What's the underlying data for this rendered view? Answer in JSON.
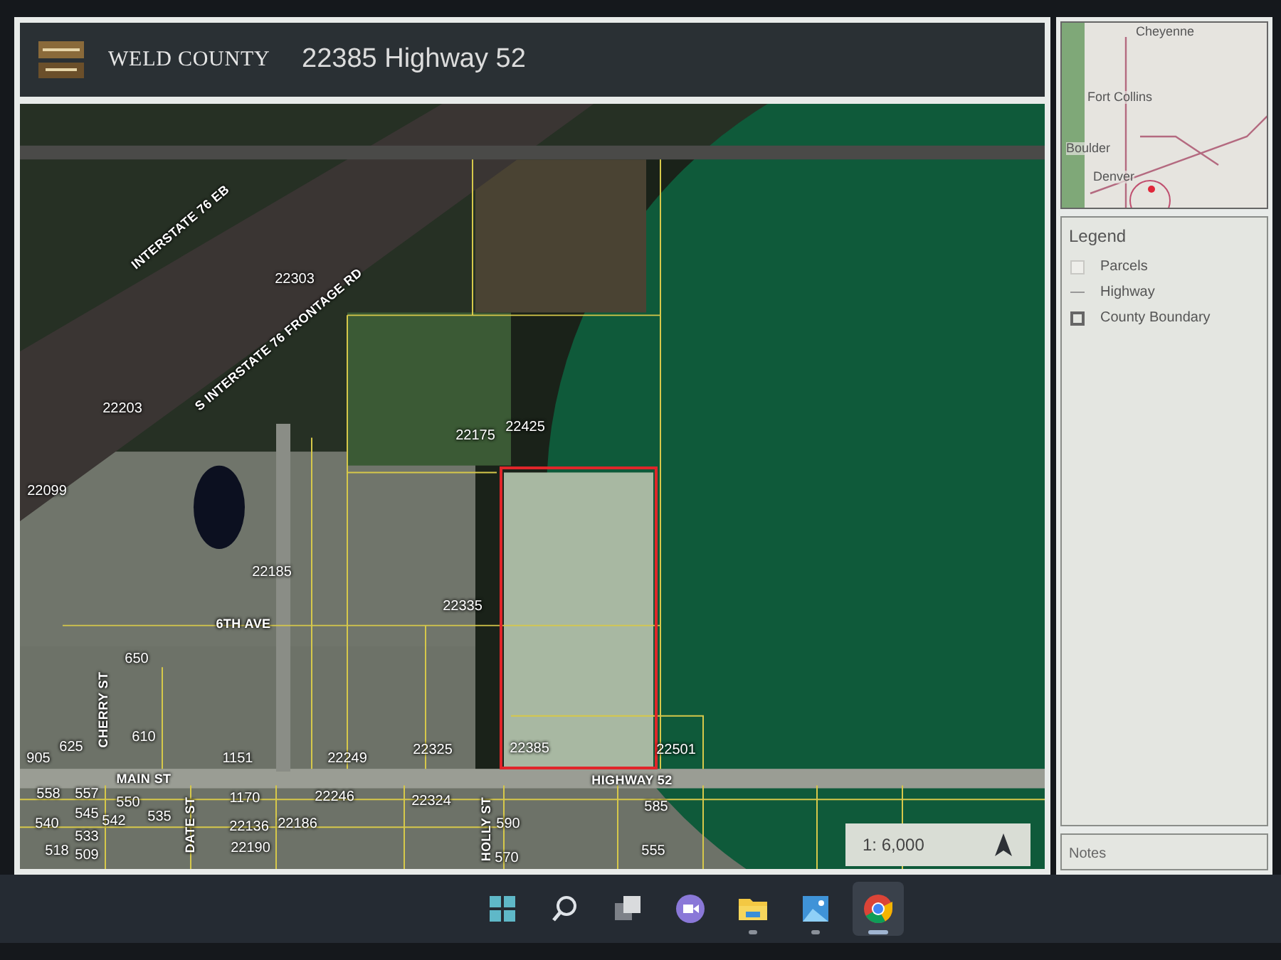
{
  "header": {
    "title": "WELD COUNTY",
    "address": "22385 Highway 52"
  },
  "map": {
    "labels": [
      {
        "text": "INTERSTATE 76 EB",
        "kind": "road"
      },
      {
        "text": "S INTERSTATE 76 FRONTAGE RD",
        "kind": "road"
      },
      {
        "text": "6TH AVE",
        "kind": "road"
      },
      {
        "text": "MAIN ST",
        "kind": "road"
      },
      {
        "text": "HIGHWAY 52",
        "kind": "road"
      },
      {
        "text": "CHERRY ST",
        "kind": "road"
      },
      {
        "text": "DATE ST",
        "kind": "road"
      },
      {
        "text": "HOLLY ST",
        "kind": "road"
      },
      {
        "text": "22303",
        "kind": "parcel"
      },
      {
        "text": "22203",
        "kind": "parcel"
      },
      {
        "text": "22175",
        "kind": "parcel"
      },
      {
        "text": "22425",
        "kind": "parcel"
      },
      {
        "text": "22099",
        "kind": "parcel"
      },
      {
        "text": "22185",
        "kind": "parcel"
      },
      {
        "text": "22335",
        "kind": "parcel"
      },
      {
        "text": "650",
        "kind": "parcel"
      },
      {
        "text": "610",
        "kind": "parcel"
      },
      {
        "text": "625",
        "kind": "parcel"
      },
      {
        "text": "905",
        "kind": "parcel"
      },
      {
        "text": "1151",
        "kind": "parcel"
      },
      {
        "text": "22249",
        "kind": "parcel"
      },
      {
        "text": "22325",
        "kind": "parcel"
      },
      {
        "text": "22385",
        "kind": "parcel"
      },
      {
        "text": "22501",
        "kind": "parcel"
      },
      {
        "text": "558",
        "kind": "parcel"
      },
      {
        "text": "557",
        "kind": "parcel"
      },
      {
        "text": "550",
        "kind": "parcel"
      },
      {
        "text": "545",
        "kind": "parcel"
      },
      {
        "text": "542",
        "kind": "parcel"
      },
      {
        "text": "535",
        "kind": "parcel"
      },
      {
        "text": "540",
        "kind": "parcel"
      },
      {
        "text": "533",
        "kind": "parcel"
      },
      {
        "text": "518",
        "kind": "parcel"
      },
      {
        "text": "509",
        "kind": "parcel"
      },
      {
        "text": "1170",
        "kind": "parcel"
      },
      {
        "text": "22136",
        "kind": "parcel"
      },
      {
        "text": "22186",
        "kind": "parcel"
      },
      {
        "text": "22190",
        "kind": "parcel"
      },
      {
        "text": "22246",
        "kind": "parcel"
      },
      {
        "text": "22324",
        "kind": "parcel"
      },
      {
        "text": "590",
        "kind": "parcel"
      },
      {
        "text": "585",
        "kind": "parcel"
      },
      {
        "text": "570",
        "kind": "parcel"
      },
      {
        "text": "555",
        "kind": "parcel"
      }
    ],
    "scale": "1: 6,000"
  },
  "overview": {
    "cities": [
      "Cheyenne",
      "Fort Collins",
      "Boulder",
      "Denver"
    ]
  },
  "legend": {
    "title": "Legend",
    "items": [
      {
        "label": "Parcels",
        "kind": "fill"
      },
      {
        "label": "Highway",
        "kind": "line"
      },
      {
        "label": "County Boundary",
        "kind": "box"
      }
    ]
  },
  "notes": {
    "title": "Notes"
  },
  "taskbar": [
    {
      "kind": "start",
      "running": false,
      "selected": false
    },
    {
      "kind": "search",
      "running": false,
      "selected": false
    },
    {
      "kind": "taskview",
      "running": false,
      "selected": false
    },
    {
      "kind": "chat",
      "running": false,
      "selected": false
    },
    {
      "kind": "folder",
      "running": true,
      "selected": false
    },
    {
      "kind": "photos",
      "running": true,
      "selected": false
    },
    {
      "kind": "browser",
      "running": true,
      "selected": true
    }
  ]
}
